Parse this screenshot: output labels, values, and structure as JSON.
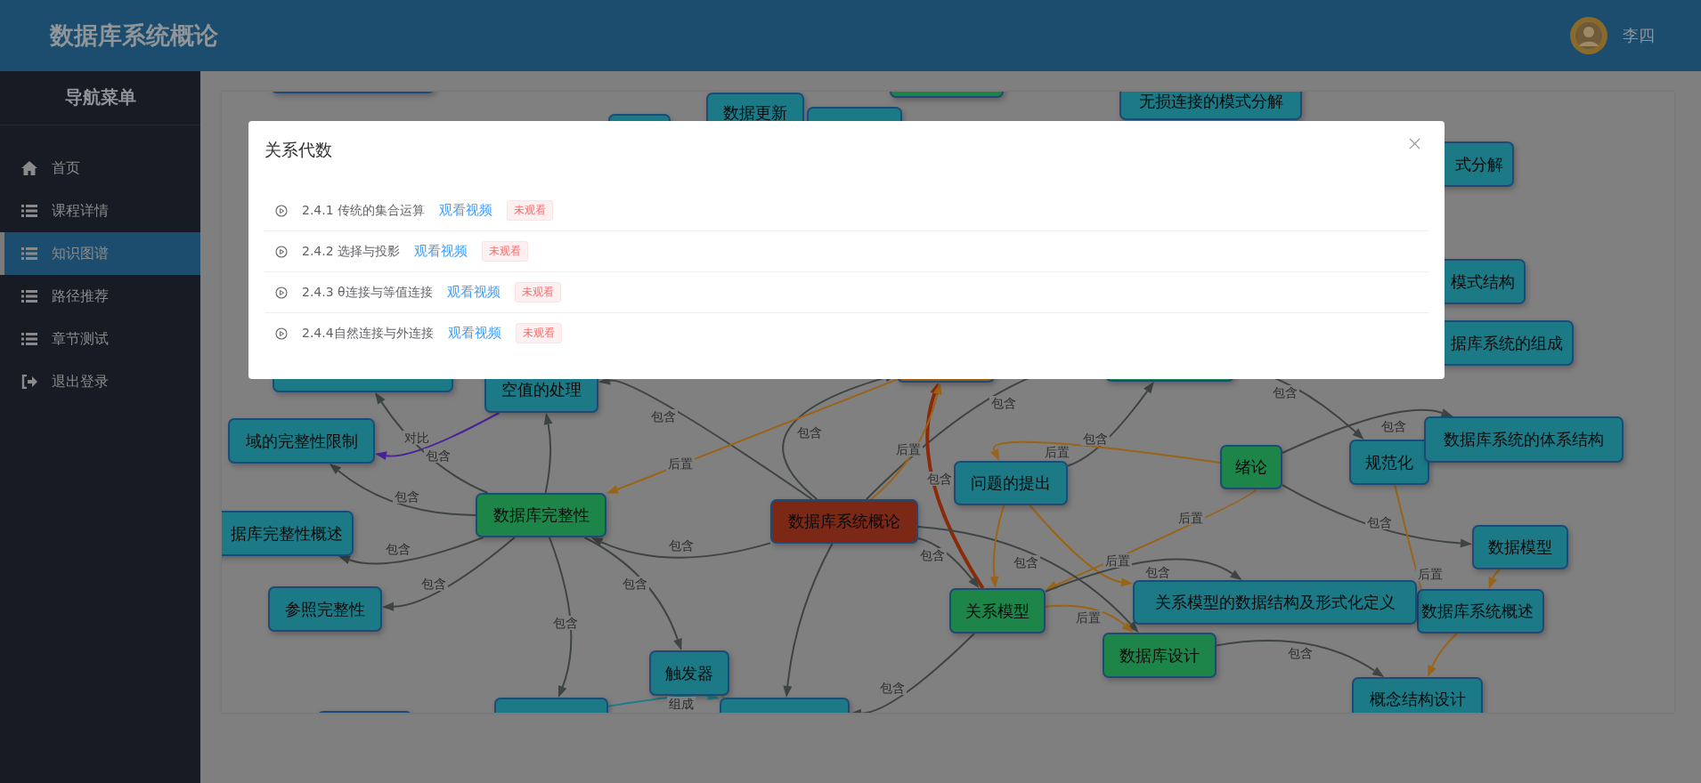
{
  "header": {
    "title": "数据库系统概论",
    "user": {
      "name": "李四"
    }
  },
  "sidebar": {
    "title": "导航菜单",
    "items": [
      {
        "label": "首页",
        "kind": "home",
        "selected": false
      },
      {
        "label": "课程详情",
        "kind": "list",
        "selected": false
      },
      {
        "label": "知识图谱",
        "kind": "list",
        "selected": true
      },
      {
        "label": "路径推荐",
        "kind": "list",
        "selected": false
      },
      {
        "label": "章节测试",
        "kind": "list",
        "selected": false
      },
      {
        "label": "退出登录",
        "kind": "logout",
        "selected": false
      }
    ]
  },
  "graph": {
    "nodes": [
      {
        "label": "无损连接的模式分解",
        "kind": "topic"
      },
      {
        "label": "式分解",
        "kind": "topic"
      },
      {
        "label": "模式结构",
        "kind": "topic"
      },
      {
        "label": "据库系统的组成",
        "kind": "topic"
      },
      {
        "label": "数据更新",
        "kind": "topic"
      },
      {
        "kind": "topic"
      },
      {
        "kind": "topic"
      },
      {
        "kind": "topic"
      },
      {
        "kind": "chapter"
      },
      {
        "kind": "current"
      },
      {
        "kind": "chapter"
      },
      {
        "label": "空值的处理",
        "kind": "topic"
      },
      {
        "kind": "topic"
      },
      {
        "label": "域的完整性限制",
        "kind": "topic"
      },
      {
        "label": "数据库完整性",
        "kind": "chapter"
      },
      {
        "label": "据库完整性概述",
        "kind": "topic"
      },
      {
        "label": "参照完整性",
        "kind": "topic"
      },
      {
        "label": "数据库系统概论",
        "kind": "course"
      },
      {
        "label": "触发器",
        "kind": "topic"
      },
      {
        "kind": "topic"
      },
      {
        "kind": "topic"
      },
      {
        "kind": "topic"
      },
      {
        "label": "问题的提出",
        "kind": "topic"
      },
      {
        "label": "绪论",
        "kind": "chapter"
      },
      {
        "label": "规范化",
        "kind": "topic"
      },
      {
        "label": "数据库系统的体系结构",
        "kind": "topic"
      },
      {
        "label": "数据模型",
        "kind": "topic"
      },
      {
        "label": "数据库系统概述",
        "kind": "topic"
      },
      {
        "label": "关系模型的数据结构及形式化定义",
        "kind": "topic"
      },
      {
        "label": "关系模型",
        "kind": "chapter"
      },
      {
        "label": "数据库设计",
        "kind": "chapter"
      },
      {
        "label": "概念结构设计",
        "kind": "topic"
      }
    ],
    "edges": [
      {
        "label": "包含",
        "kind": "contains"
      },
      {
        "label": "包含",
        "kind": "contains"
      },
      {
        "label": "包含",
        "kind": "contains"
      },
      {
        "label": "包含",
        "kind": "contains"
      },
      {
        "label": "包含",
        "kind": "contains"
      },
      {
        "label": "对比",
        "kind": "compare"
      },
      {
        "label": "包含",
        "kind": "contains"
      },
      {
        "label": "包含",
        "kind": "contains"
      },
      {
        "label": "后置",
        "kind": "prereq"
      },
      {
        "label": "后置",
        "kind": "prereq"
      },
      {
        "label": "包含",
        "kind": "strong"
      },
      {
        "label": "后置",
        "kind": "prereq"
      },
      {
        "label": "包含",
        "kind": "contains"
      },
      {
        "label": "后置",
        "kind": "prereq"
      },
      {
        "label": "包含",
        "kind": "contains"
      },
      {
        "label": "包含",
        "kind": "contains"
      },
      {
        "label": "包含",
        "kind": "contains"
      },
      {
        "label": "包含",
        "kind": "contains"
      },
      {
        "label": "包含",
        "kind": "contains"
      },
      {
        "label": "后置",
        "kind": "prereq"
      },
      {
        "label": "包含",
        "kind": "contains"
      },
      {
        "label": "后置",
        "kind": "prereq"
      },
      {
        "label": "包含",
        "kind": "contains"
      },
      {
        "label": "包含",
        "kind": "contains"
      },
      {
        "label": "后置",
        "kind": "prereq"
      },
      {
        "label": "包含",
        "kind": "contains"
      },
      {
        "label": "包含",
        "kind": "contains"
      },
      {
        "label": "包含",
        "kind": "contains"
      },
      {
        "label": "组成",
        "kind": "compose"
      },
      {
        "kind": "contains"
      },
      {
        "kind": "contains"
      },
      {
        "kind": "link"
      },
      {
        "kind": "prereq"
      },
      {
        "kind": "prereq"
      },
      {
        "kind": "prereq"
      }
    ]
  },
  "dialog": {
    "title": "关系代数",
    "items": [
      {
        "title": "2.4.1 传统的集合运算",
        "link": "观看视频",
        "status": "未观看",
        "watched": false
      },
      {
        "title": "2.4.2 选择与投影",
        "link": "观看视频",
        "status": "未观看",
        "watched": false
      },
      {
        "title": "2.4.3 θ连接与等值连接",
        "link": "观看视频",
        "status": "未观看",
        "watched": false
      },
      {
        "title": "2.4.4自然连接与外连接",
        "link": "观看视频",
        "status": "未观看",
        "watched": false
      }
    ]
  }
}
